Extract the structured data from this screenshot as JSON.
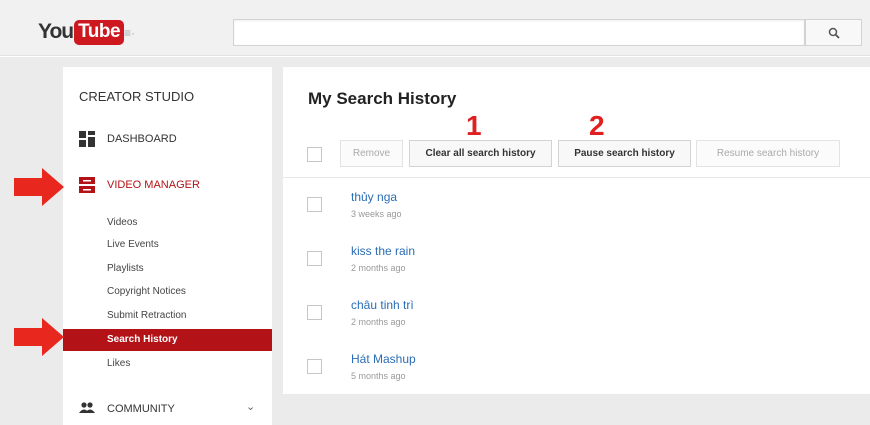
{
  "header": {
    "logo_you": "You",
    "logo_tube": "Tube",
    "guide_glyph": "≡·",
    "search_placeholder": "",
    "search_icon": "search-icon"
  },
  "sidebar": {
    "title": "CREATOR STUDIO",
    "items": [
      {
        "label": "DASHBOARD",
        "icon": "dashboard-icon"
      },
      {
        "label": "VIDEO MANAGER",
        "icon": "video-manager-icon"
      },
      {
        "label": "COMMUNITY",
        "icon": "community-icon"
      }
    ],
    "subitems": [
      "Videos",
      "Live Events",
      "Playlists",
      "Copyright Notices",
      "Submit Retraction",
      "Search History",
      "Likes"
    ],
    "active_subitem": "Search History",
    "accent_color": "#b31217"
  },
  "main": {
    "title": "My Search History",
    "toolbar": {
      "remove_label": "Remove",
      "clear_label": "Clear all search history",
      "pause_label": "Pause search history",
      "resume_label": "Resume search history"
    },
    "annotations": [
      "1",
      "2"
    ],
    "history": [
      {
        "query": "thủy nga",
        "time": "3 weeks ago"
      },
      {
        "query": "kiss the rain",
        "time": "2 months ago"
      },
      {
        "query": "châu tinh trì",
        "time": "2 months ago"
      },
      {
        "query": "Hát Mashup",
        "time": "5 months ago"
      }
    ],
    "link_color": "#2a6db6",
    "annotation_color": "#e02020"
  }
}
